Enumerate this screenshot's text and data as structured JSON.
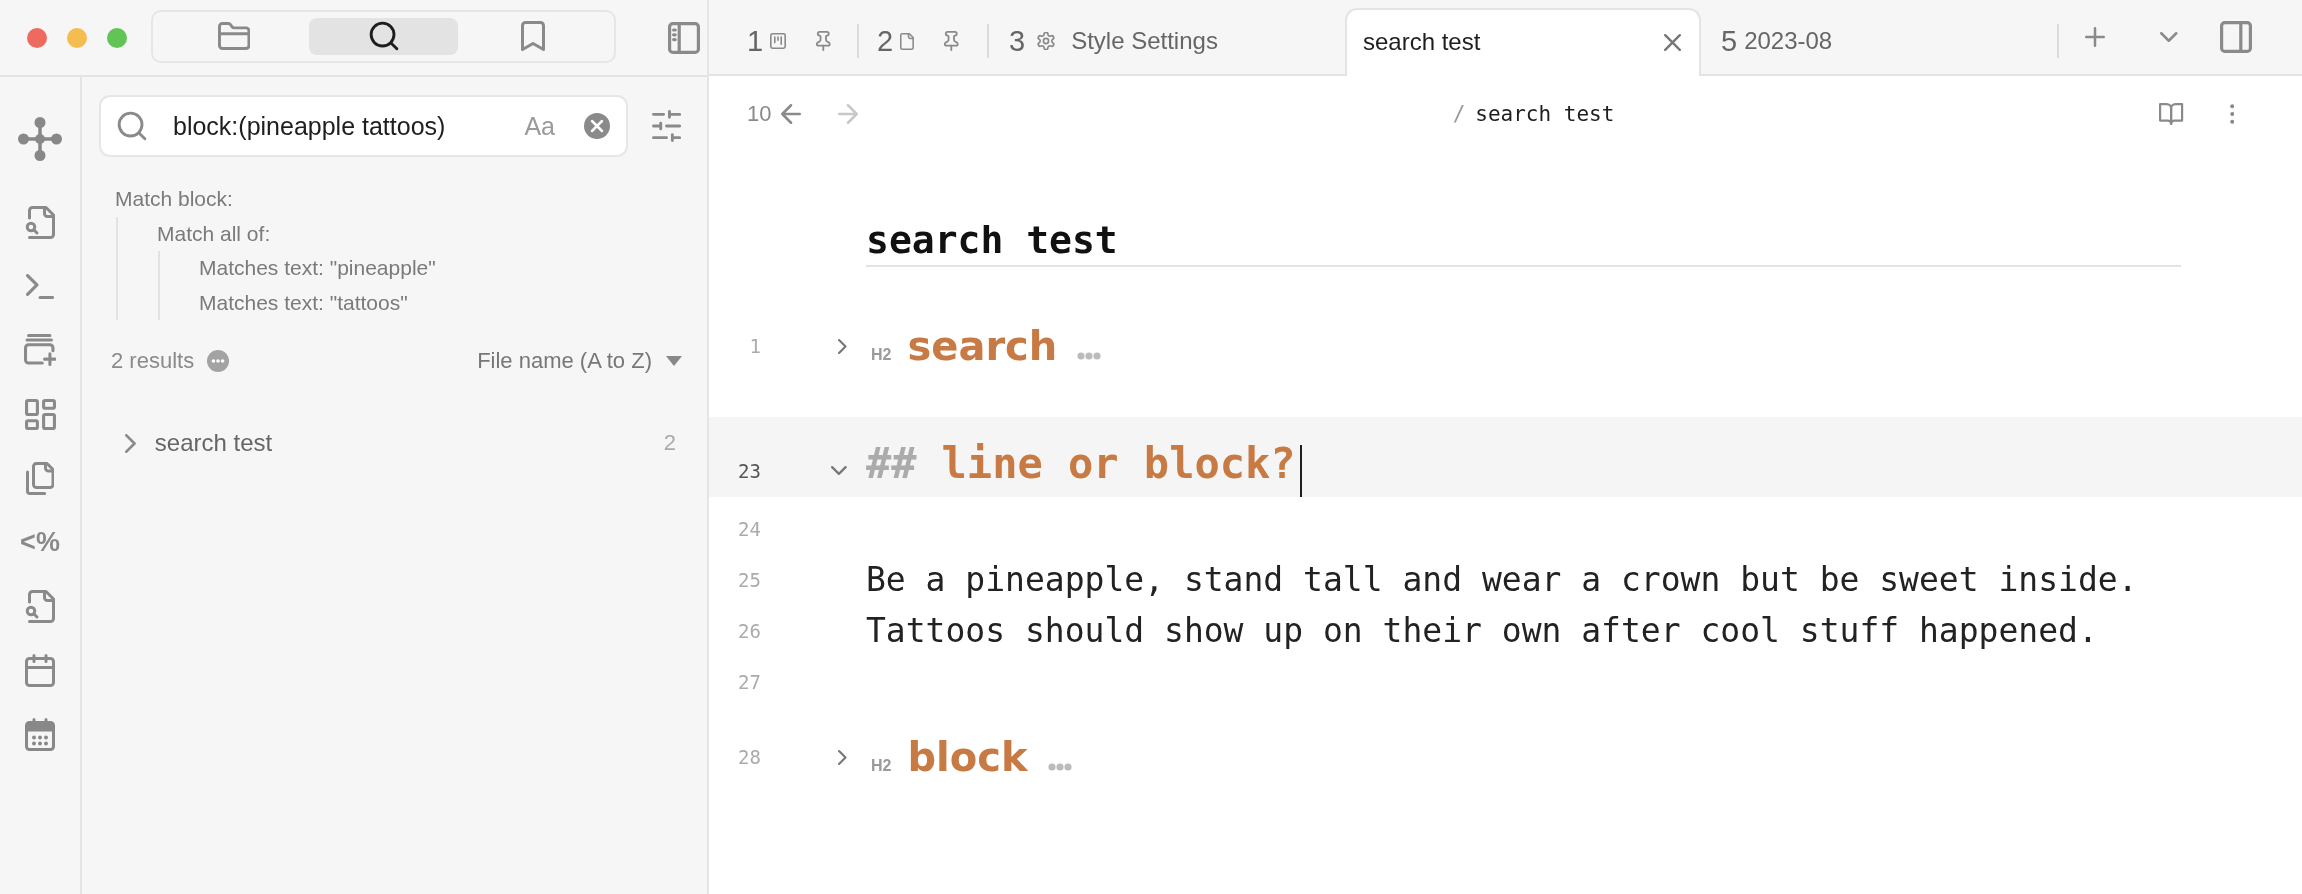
{
  "sidebar_tabs": [
    {
      "kind": "files",
      "selected": false
    },
    {
      "kind": "search",
      "selected": true
    },
    {
      "kind": "bookmarks",
      "selected": false
    }
  ],
  "ribbon": [
    {
      "kind": "graph"
    },
    {
      "kind": "file-search"
    },
    {
      "kind": "terminal"
    },
    {
      "kind": "canvas"
    },
    {
      "kind": "dashboard"
    },
    {
      "kind": "copy"
    },
    {
      "kind": "template",
      "glyph": "<%"
    },
    {
      "kind": "file-search"
    },
    {
      "kind": "calendar"
    },
    {
      "kind": "calendar-grid"
    }
  ],
  "search": {
    "query": "block:(pineapple tattoos)",
    "match_case_label": "Aa",
    "explanation": [
      {
        "label": "Match block:",
        "children": [
          {
            "label": "Match all of:",
            "children": [
              {
                "label": "Matches text: \"pineapple\""
              },
              {
                "label": "Matches text: \"tattoos\""
              }
            ]
          }
        ]
      }
    ],
    "results_count": "2 results",
    "sort": "File name (A to Z)",
    "results": [
      {
        "title": "search test",
        "count": "2",
        "expanded": false
      }
    ]
  },
  "tabs": [
    {
      "number": "1",
      "kind": "board",
      "pinned": true,
      "selected": false
    },
    {
      "number": "2",
      "kind": "file",
      "pinned": true,
      "selected": false
    },
    {
      "number": "3",
      "kind": "settings",
      "label": "Style Settings",
      "pinned": false,
      "selected": false
    },
    {
      "kind": "note",
      "label": "search test",
      "pinned": false,
      "selected": true
    },
    {
      "number": "5",
      "kind": "note",
      "label": "2023-08",
      "pinned": false,
      "selected": false
    }
  ],
  "nav": {
    "history_count": "10",
    "back_disabled": false,
    "forward_disabled": true,
    "separator": "/",
    "title": "search test"
  },
  "editor": {
    "title": "search test",
    "lines": [
      {
        "number": "1",
        "kind": "heading",
        "tag": "H2",
        "text": "search",
        "collapsed": true,
        "active": false
      },
      {
        "number": "23",
        "kind": "source-heading",
        "markup": "##",
        "text": "line or block?",
        "collapsed": false,
        "active": true
      },
      {
        "number": "24",
        "kind": "blank",
        "active": false
      },
      {
        "number": "25",
        "kind": "text",
        "text": "Be a pineapple, stand tall and wear a crown but be sweet inside.",
        "active": false
      },
      {
        "number": "26",
        "kind": "text",
        "text": "Tattoos should show up on their own after cool stuff happened.",
        "active": false
      },
      {
        "number": "27",
        "kind": "blank",
        "active": false
      },
      {
        "number": "28",
        "kind": "heading",
        "tag": "H2",
        "text": "block",
        "collapsed": true,
        "active": false
      }
    ]
  }
}
